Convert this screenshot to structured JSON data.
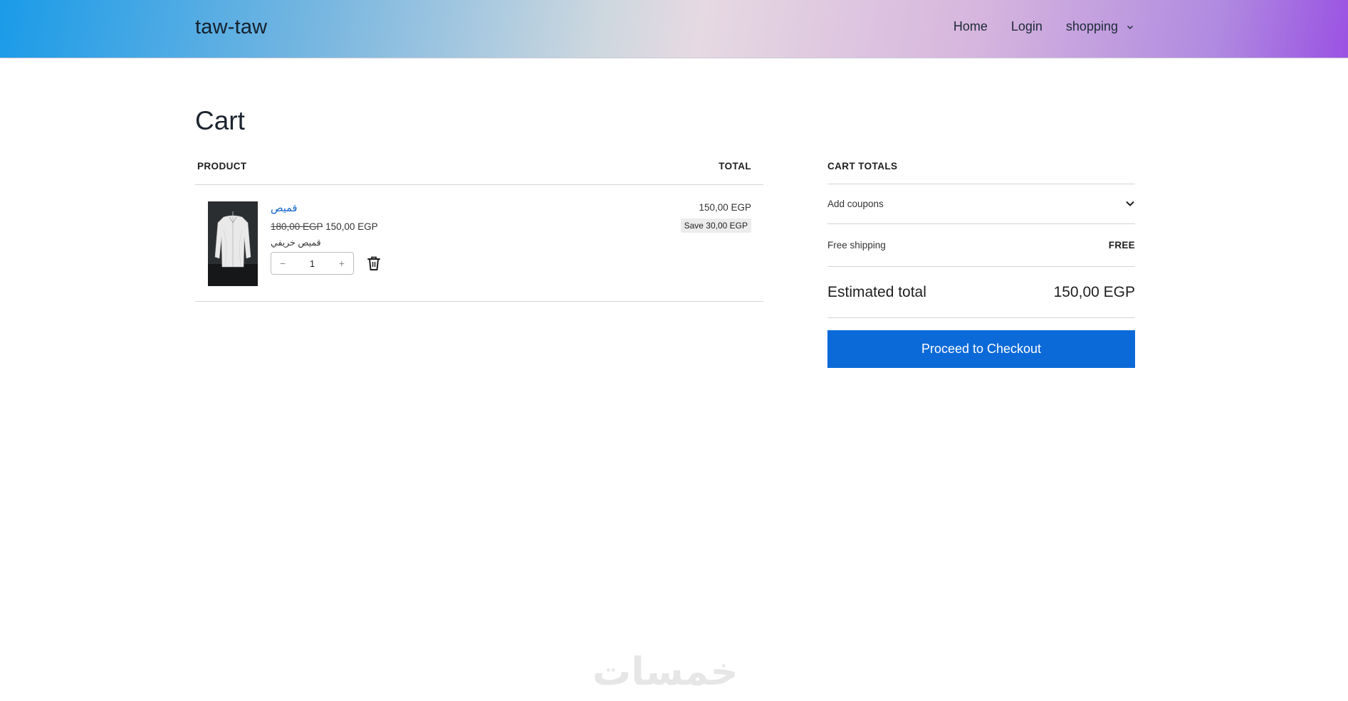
{
  "header": {
    "logo": "taw-taw",
    "nav": [
      {
        "label": "Home"
      },
      {
        "label": "Login"
      },
      {
        "label": "shopping"
      }
    ]
  },
  "page": {
    "title": "Cart"
  },
  "cart_table": {
    "headers": {
      "product": "PRODUCT",
      "total": "TOTAL"
    },
    "items": [
      {
        "name": "قميص",
        "old_price": "180,00 EGP",
        "price": "150,00 EGP",
        "description": "قميص خريفي",
        "quantity": "1",
        "line_total": "150,00 EGP",
        "save_label": "Save 30,00 EGP",
        "image_icon": "shirt-image"
      }
    ]
  },
  "totals": {
    "heading": "CART TOTALS",
    "coupons_label": "Add coupons",
    "shipping_label": "Free shipping",
    "shipping_value": "FREE",
    "estimated_label": "Estimated total",
    "estimated_value": "150,00 EGP",
    "checkout_label": "Proceed to Checkout"
  },
  "watermark": {
    "text": "خمسات"
  },
  "colors": {
    "accent": "#0b6ad8",
    "link": "#0e63c9"
  }
}
